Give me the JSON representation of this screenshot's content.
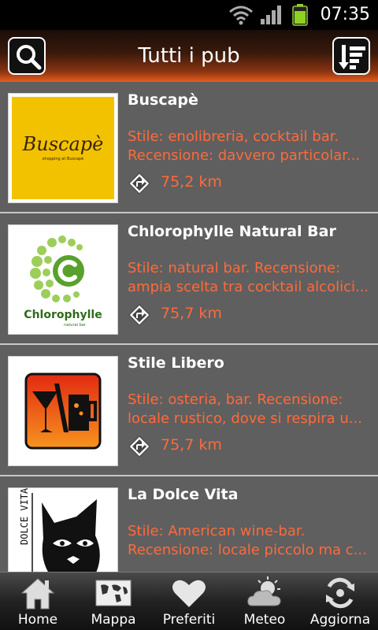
{
  "status_bar": {
    "time": "07:35"
  },
  "header": {
    "title": "Tutti i pub"
  },
  "pubs": [
    {
      "name": "Buscapè",
      "desc_line1": "  Stile: enolibreria, cocktail bar.",
      "desc_line2": "Recensione: davvero particolar...",
      "distance": "75,2 km",
      "logo_text": "Buscapè",
      "logo_sub": "shopping at Buscapè"
    },
    {
      "name": "Chlorophylle Natural Bar",
      "desc_line1": "  Stile: natural bar.  Recensione:",
      "desc_line2": "ampia scelta tra cocktail alcolici...",
      "distance": "75,7 km",
      "logo_text": "Chlorophylle",
      "logo_sub": "natural bar"
    },
    {
      "name": "Stile Libero",
      "desc_line1": "  Stile: osteria, bar.  Recensione:",
      "desc_line2": "locale rustico, dove si respira u...",
      "distance": "75,7 km"
    },
    {
      "name": "La Dolce Vita",
      "desc_line1": "  Stile: American wine-bar.",
      "desc_line2": "Recensione: locale piccolo ma c...",
      "distance": "",
      "logo_text": "DOLCE VITA"
    }
  ],
  "nav": [
    {
      "label": "Home",
      "icon": "home-icon"
    },
    {
      "label": "Mappa",
      "icon": "map-icon"
    },
    {
      "label": "Preferiti",
      "icon": "heart-icon"
    },
    {
      "label": "Meteo",
      "icon": "weather-icon"
    },
    {
      "label": "Aggiorna",
      "icon": "refresh-icon"
    }
  ],
  "colors": {
    "accent": "#ff6a3a",
    "header_orange": "#e85d1e",
    "list_bg": "#5f5f5f",
    "buscape_yellow": "#f2c200",
    "chlorophylle_green": "#5aa02c"
  }
}
